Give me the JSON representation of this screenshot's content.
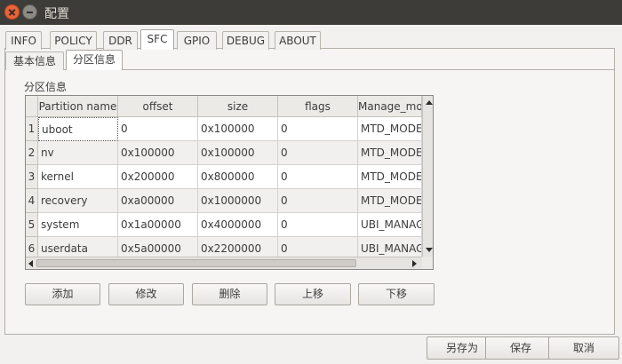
{
  "window": {
    "title": "配置"
  },
  "tabs": [
    "INFO",
    "POLICY",
    "DDR",
    "SFC",
    "GPIO",
    "DEBUG",
    "ABOUT"
  ],
  "subtabs": [
    "基本信息",
    "分区信息"
  ],
  "group_label": "分区信息",
  "table": {
    "columns": [
      "Partition name",
      "offset",
      "size",
      "flags",
      "Manage_mo"
    ],
    "row_numbers": [
      "1",
      "2",
      "3",
      "4",
      "5",
      "6"
    ],
    "rows": [
      [
        "uboot",
        "0",
        "0x100000",
        "0",
        "MTD_MODE"
      ],
      [
        "nv",
        "0x100000",
        "0x100000",
        "0",
        "MTD_MODE"
      ],
      [
        "kernel",
        "0x200000",
        "0x800000",
        "0",
        "MTD_MODE"
      ],
      [
        "recovery",
        "0xa00000",
        "0x1000000",
        "0",
        "MTD_MODE"
      ],
      [
        "system",
        "0x1a00000",
        "0x4000000",
        "0",
        "UBI_MANAGE"
      ],
      [
        "userdata",
        "0x5a00000",
        "0x2200000",
        "0",
        "UBI_MANAGE"
      ]
    ]
  },
  "actions": {
    "add": "添加",
    "edit": "修改",
    "delete": "删除",
    "move_up": "上移",
    "move_down": "下移"
  },
  "footer": {
    "save_as": "另存为",
    "save": "保存",
    "cancel": "取消"
  },
  "active_tab": "SFC",
  "active_subtab": "分区信息"
}
